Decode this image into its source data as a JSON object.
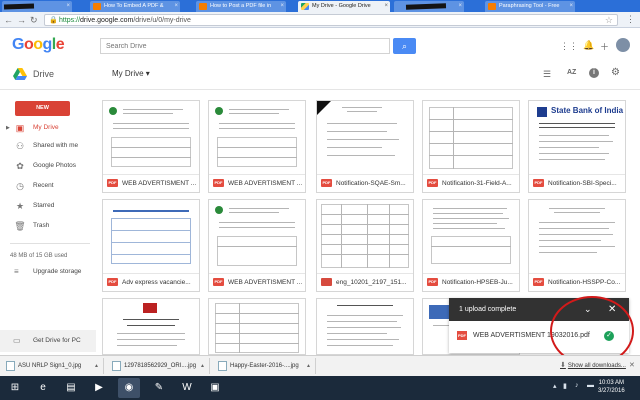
{
  "browser": {
    "tabs": [
      {
        "title": "",
        "icon": "redacted",
        "active": false
      },
      {
        "title": "How To Embed A PDF &",
        "icon": "blogger",
        "active": false
      },
      {
        "title": "How to Post a PDF file in",
        "icon": "blogger",
        "active": false
      },
      {
        "title": "My Drive - Google Drive",
        "icon": "drive",
        "active": true
      },
      {
        "title": "",
        "icon": "blogger",
        "active": false
      },
      {
        "title": "Paraphrasing Tool - Free",
        "icon": "blogger",
        "active": false
      }
    ],
    "url_scheme": "https://",
    "url_host": "drive.google.com",
    "url_path": "/drive/u/0/my-drive"
  },
  "header": {
    "logo": "Google",
    "search_placeholder": "Search Drive",
    "app_name": "Drive",
    "location": "My Drive"
  },
  "sidebar": {
    "new_label": "NEW",
    "items": [
      {
        "label": "My Drive",
        "icon": "folder-icon",
        "active": true
      },
      {
        "label": "Shared with me",
        "icon": "people-icon",
        "active": false
      },
      {
        "label": "Google Photos",
        "icon": "photos-icon",
        "active": false
      },
      {
        "label": "Recent",
        "icon": "clock-icon",
        "active": false
      },
      {
        "label": "Starred",
        "icon": "star-icon",
        "active": false
      },
      {
        "label": "Trash",
        "icon": "trash-icon",
        "active": false
      }
    ],
    "storage": "48 MB of 15 GB used",
    "upgrade": "Upgrade storage",
    "get_drive": "Get Drive for PC"
  },
  "files": [
    {
      "name": "WEB ADVERTISMENT ...",
      "type": "pdf"
    },
    {
      "name": "WEB ADVERTISMENT ...",
      "type": "pdf"
    },
    {
      "name": "Notification-SQAE-Sm...",
      "type": "pdf"
    },
    {
      "name": "Notification-31-Field-A...",
      "type": "pdf"
    },
    {
      "name": "Notification-SBI-Speci...",
      "type": "pdf"
    },
    {
      "name": "Adv express vacancie...",
      "type": "pdf"
    },
    {
      "name": "WEB ADVERTISMENT ...",
      "type": "pdf"
    },
    {
      "name": "eng_10201_2197_151...",
      "type": "image"
    },
    {
      "name": "Notification-HPSEB-Ju...",
      "type": "pdf"
    },
    {
      "name": "Notification-HSSPP-Co...",
      "type": "pdf"
    },
    {
      "name": "",
      "type": "pdf"
    },
    {
      "name": "",
      "type": "pdf"
    },
    {
      "name": "",
      "type": "pdf"
    },
    {
      "name": "",
      "type": "pdf"
    }
  ],
  "upload": {
    "title": "1 upload complete",
    "file": "WEB ADVERTISMENT 19032016.pdf"
  },
  "downloads": [
    {
      "name": "ASU NRLP Sign1_0.jpg"
    },
    {
      "name": "1297818562929_ORI....jpg"
    },
    {
      "name": "Happy-Easter-2016-....jpg"
    }
  ],
  "show_all_downloads": "Show all downloads...",
  "taskbar": {
    "time": "10:03 AM",
    "date": "3/27/2016"
  },
  "colors": {
    "tab_strip": "#2b6fd8",
    "new_button": "#d94235",
    "search_button": "#4a8af4",
    "upload_header": "#323232",
    "annotation_circle": "#d21a1a"
  }
}
